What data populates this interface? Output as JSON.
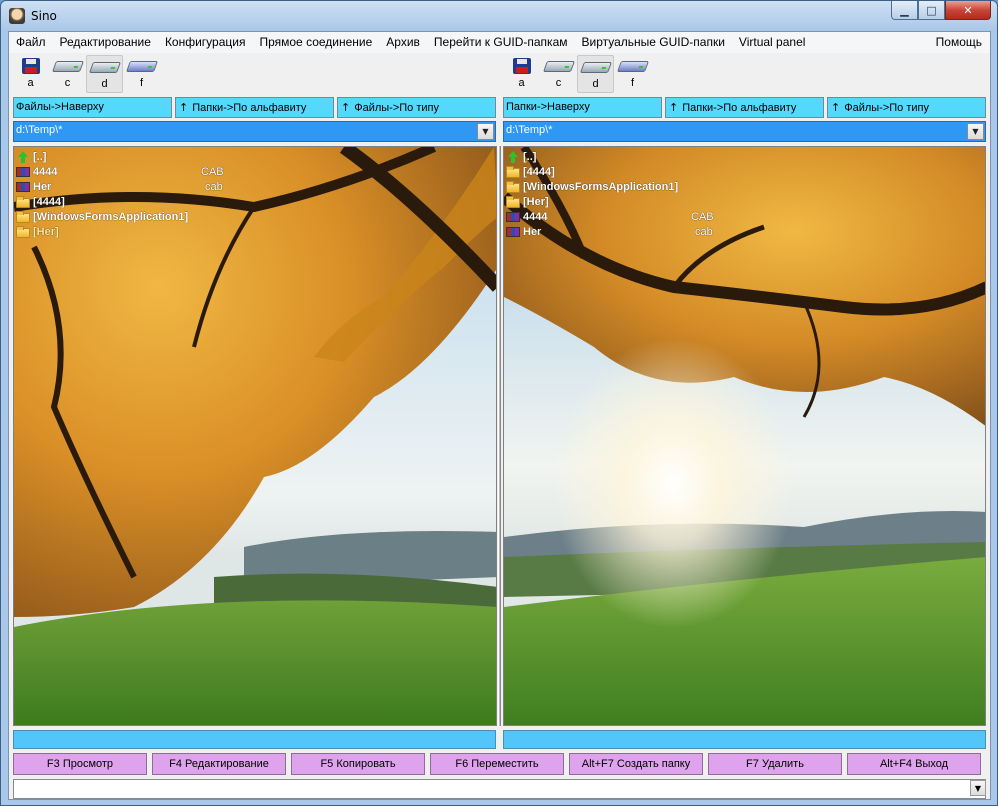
{
  "window": {
    "title": "Sino",
    "controls": {
      "minimize": "▁",
      "maximize": "□",
      "close": "✕"
    }
  },
  "menu": [
    "Файл",
    "Редактирование",
    "Конфигурация",
    "Прямое соединение",
    "Архив",
    "Перейти к GUID-папкам",
    "Виртуальные GUID-папки",
    "Virtual panel",
    "Помощь"
  ],
  "left": {
    "drives": [
      {
        "label": "a",
        "icon": "floppy-icon"
      },
      {
        "label": "c",
        "icon": "hard-drive-icon"
      },
      {
        "label": "d",
        "icon": "hard-drive-icon",
        "selected": true
      },
      {
        "label": "f",
        "icon": "usb-drive-icon"
      }
    ],
    "sort": {
      "files_up": "Файлы->Наверху",
      "folders_alpha": "Папки->По альфавиту",
      "files_type": "Файлы->По типу",
      "arrow": "↑"
    },
    "path": "d:\\Temp\\*",
    "files": [
      {
        "name": "[..]",
        "ext": "",
        "kind": "up"
      },
      {
        "name": "4444",
        "ext": "CAB",
        "kind": "cab"
      },
      {
        "name": "Her",
        "ext": "cab",
        "kind": "cab"
      },
      {
        "name": "[4444]",
        "ext": "",
        "kind": "folder"
      },
      {
        "name": "[WindowsFormsApplication1]",
        "ext": "",
        "kind": "folder"
      },
      {
        "name": "[Her]",
        "ext": "",
        "kind": "folder"
      }
    ],
    "status": ""
  },
  "right": {
    "drives": [
      {
        "label": "a",
        "icon": "floppy-icon"
      },
      {
        "label": "c",
        "icon": "hard-drive-icon"
      },
      {
        "label": "d",
        "icon": "hard-drive-icon",
        "selected": true
      },
      {
        "label": "f",
        "icon": "usb-drive-icon"
      }
    ],
    "sort": {
      "files_up": "Папки->Наверху",
      "folders_alpha": "Папки->По альфавиту",
      "files_type": "Файлы->По типу",
      "arrow": "↑"
    },
    "path": "d:\\Temp\\*",
    "files": [
      {
        "name": "[..]",
        "ext": "",
        "kind": "up"
      },
      {
        "name": "[4444]",
        "ext": "",
        "kind": "folder"
      },
      {
        "name": "[WindowsFormsApplication1]",
        "ext": "",
        "kind": "folder"
      },
      {
        "name": "[Her]",
        "ext": "",
        "kind": "folder"
      },
      {
        "name": "4444",
        "ext": "CAB",
        "kind": "cab"
      },
      {
        "name": "Her",
        "ext": "cab",
        "kind": "cab"
      }
    ],
    "status": ""
  },
  "fkeys": [
    "F3 Просмотр",
    "F4 Редактирование",
    "F5 Копировать",
    "F6 Переместить",
    "Alt+F7 Создать папку",
    "F7 Удалить",
    "Alt+F4 Выход"
  ],
  "command_line": {
    "value": ""
  },
  "colors": {
    "sort_button": "#54d8fb",
    "path_combo": "#2f98f4",
    "status_bar": "#52c6fb",
    "fkey_button": "#dfa2ec"
  }
}
